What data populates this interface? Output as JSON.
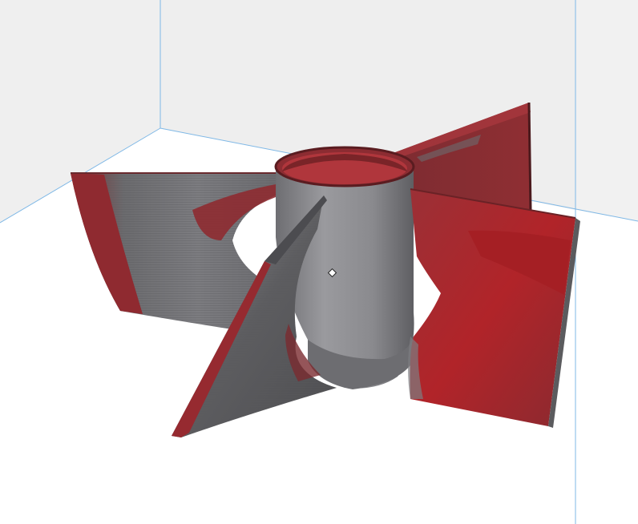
{
  "viewport": {
    "background_color": "#ffffff",
    "wall_color": "#efefef",
    "grid_line_color": "#7fb8e6"
  },
  "model": {
    "description_icon": "3d-impeller-model-icon",
    "base_grey": "#6f6f72",
    "hub_grey": "#8a8a8e",
    "overhang_red": "#8f2a30",
    "deep_red": "#a51f24"
  },
  "cursor": {
    "icon": "pivot-point-icon"
  }
}
